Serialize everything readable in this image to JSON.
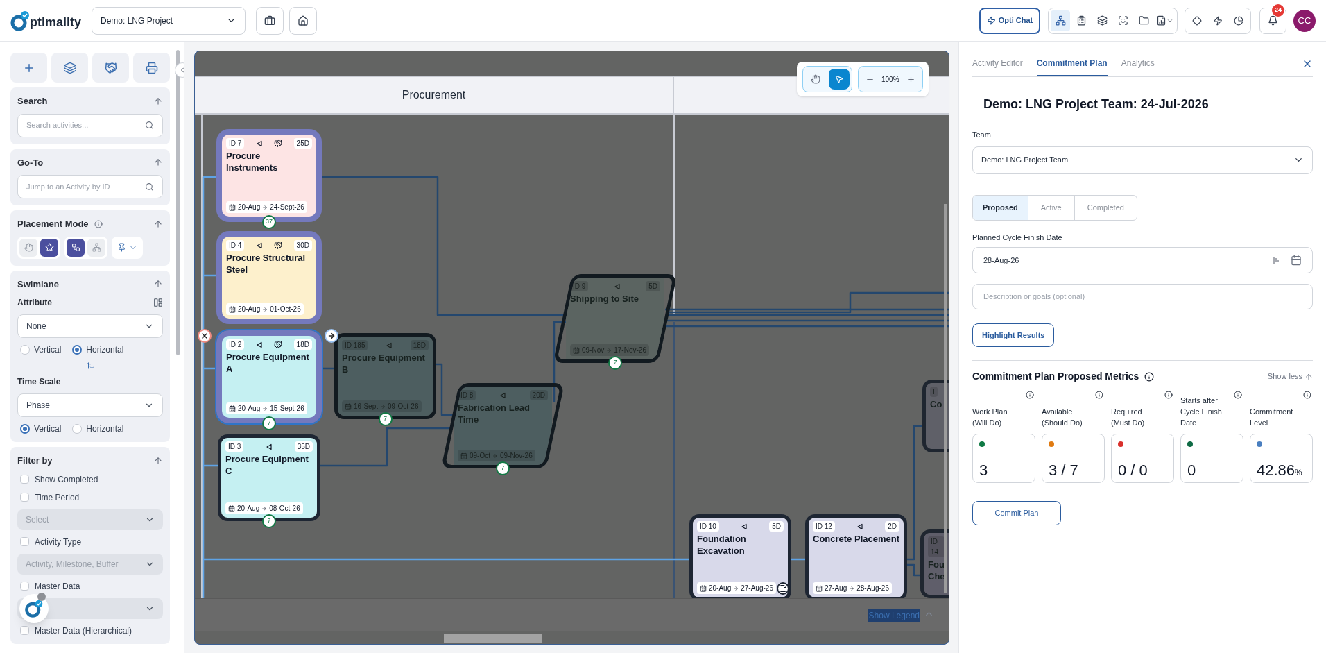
{
  "header": {
    "logo_text": "ptimality",
    "project": "Demo: LNG Project",
    "opti_chat": "Opti Chat",
    "notifications": "24",
    "avatar": "CC"
  },
  "sidebar": {
    "search": {
      "title": "Search",
      "placeholder": "Search activities..."
    },
    "goto": {
      "title": "Go-To",
      "placeholder": "Jump to an Activity by ID"
    },
    "placement": {
      "title": "Placement Mode",
      "groups": [
        {
          "items": [
            {
              "kind": "hand",
              "selected": false
            },
            {
              "kind": "star",
              "selected": true
            }
          ]
        },
        {
          "items": [
            {
              "kind": "flow",
              "selected": true
            },
            {
              "kind": "tree",
              "selected": false
            }
          ]
        }
      ]
    },
    "swimlane": {
      "title": "Swimlane",
      "attribute_label": "Attribute",
      "attribute_value": "None",
      "orientation": [
        {
          "label": "Vertical",
          "selected": false
        },
        {
          "label": "Horizontal",
          "selected": true
        }
      ],
      "time_scale_label": "Time Scale",
      "time_scale_value": "Phase",
      "time_orientation": [
        {
          "label": "Vertical",
          "selected": true
        },
        {
          "label": "Horizontal",
          "selected": false
        }
      ]
    },
    "filter": {
      "title": "Filter by",
      "items": [
        {
          "kind": "checkbox",
          "label": "Show Completed",
          "checked": false
        },
        {
          "kind": "checkbox",
          "label": "Time Period",
          "checked": false
        },
        {
          "kind": "select",
          "placeholder": "Select",
          "disabled": true
        },
        {
          "kind": "checkbox",
          "label": "Activity Type",
          "checked": false
        },
        {
          "kind": "select",
          "placeholder": "Activity, Milestone, Buffer",
          "disabled": true
        },
        {
          "kind": "checkbox",
          "label": "Master Data",
          "checked": false
        },
        {
          "kind": "select",
          "disabled": true
        },
        {
          "kind": "checkbox",
          "label": "Master Data (Hierarchical)",
          "checked": false
        }
      ]
    }
  },
  "canvas": {
    "lanes": [
      {
        "title": "Procurement"
      }
    ],
    "tools": [
      {
        "kind": "hand",
        "selected": false
      },
      {
        "kind": "pointer",
        "selected": true
      }
    ],
    "zoom": "100%",
    "legend": "Show Legend",
    "nodes": [
      {
        "id": "ID 7",
        "duration": "25D",
        "name": "Procure Instruments",
        "start": "20-Aug",
        "end": "24-Sept-26",
        "badge": "37",
        "kind": "highlighted",
        "color": "#fde4e4",
        "handshake": true,
        "selected": false
      },
      {
        "id": "ID 4",
        "duration": "30D",
        "name": "Procure Structural Steel",
        "start": "20-Aug",
        "end": "01-Oct-26",
        "kind": "highlighted",
        "color": "#fdf0cc",
        "handshake": true,
        "selected": false
      },
      {
        "id": "ID 2",
        "duration": "18D",
        "name": "Procure Equipment A",
        "start": "20-Aug",
        "end": "15-Sept-26",
        "badge": "7",
        "kind": "highlighted",
        "color": "#c5f0f2",
        "handshake": true,
        "selected": true
      },
      {
        "id": "ID 3",
        "duration": "35D",
        "name": "Procure Equipment C",
        "start": "20-Aug",
        "end": "08-Oct-26",
        "badge": "7",
        "kind": "plain",
        "color": "#c5f0f2",
        "handshake": false,
        "selected": false
      },
      {
        "id": "ID 185",
        "duration": "18D",
        "name": "Procure Equipment B",
        "start": "16-Sept",
        "end": "09-Oct-26",
        "badge": "7",
        "kind": "dimmed",
        "color": "#4d5e60",
        "handshake": false,
        "selected": false
      },
      {
        "id": "ID 8",
        "duration": "20D",
        "name": "Fabrication Lead Time",
        "start": "09-Oct",
        "end": "09-Nov-26",
        "badge": "7",
        "kind": "slanted",
        "color": "#4d5e60",
        "handshake": false,
        "selected": false
      },
      {
        "id": "ID 9",
        "duration": "5D",
        "name": "Shipping to Site",
        "start": "09-Nov",
        "end": "17-Nov-26",
        "badge": "7",
        "kind": "slanted",
        "color": "#5b6461",
        "handshake": false,
        "selected": false
      },
      {
        "id": "ID 10",
        "duration": "5D",
        "name": "Foundation Excavation",
        "start": "20-Aug",
        "end": "27-Aug-26",
        "kind": "plain",
        "color": "#d8d9ea",
        "handshake": false,
        "selected": false,
        "note": true
      },
      {
        "id": "ID 12",
        "duration": "2D",
        "name": "Concrete Placement",
        "start": "27-Aug",
        "end": "28-Aug-26",
        "kind": "plain",
        "color": "#d8d9ea",
        "handshake": false,
        "selected": false
      },
      {
        "id": "I",
        "name": "Co",
        "kind": "partial",
        "color": "#5f6068",
        "handshake": false,
        "selected": false
      },
      {
        "id": "ID 14",
        "name": "Fou Che",
        "kind": "partial",
        "color": "#5f5e6a",
        "handshake": false,
        "selected": false
      }
    ]
  },
  "panel": {
    "tabs": [
      {
        "label": "Activity Editor",
        "selected": false
      },
      {
        "label": "Commitment Plan",
        "selected": true
      },
      {
        "label": "Analytics",
        "selected": false
      }
    ],
    "title": "Demo: LNG Project Team: 24-Jul-2026",
    "team_label": "Team",
    "team_value": "Demo: LNG Project Team",
    "status_tabs": [
      {
        "label": "Proposed",
        "selected": true
      },
      {
        "label": "Active",
        "selected": false
      },
      {
        "label": "Completed",
        "selected": false
      }
    ],
    "date_label": "Planned Cycle Finish Date",
    "date_value": "28-Aug-26",
    "description_placeholder": "Description or goals (optional)",
    "highlight_button": "Highlight Results",
    "metrics_title": "Commitment Plan Proposed Metrics",
    "show_less": "Show less",
    "metrics": [
      {
        "label": "Work Plan (Will Do)",
        "value": "3",
        "color": "#0f7a45"
      },
      {
        "label": "Available (Should Do)",
        "value": "3 / 7",
        "color": "#e07b12"
      },
      {
        "label": "Required (Must Do)",
        "value": "0 / 0",
        "color": "#d9302c"
      },
      {
        "label": "Starts after Cycle Finish Date",
        "value": "0",
        "color": "#0f6b45"
      },
      {
        "label": "Commitment Level",
        "value": "42.86",
        "unit": "%",
        "color": "#4a7fc0"
      }
    ],
    "commit_button": "Commit Plan"
  }
}
